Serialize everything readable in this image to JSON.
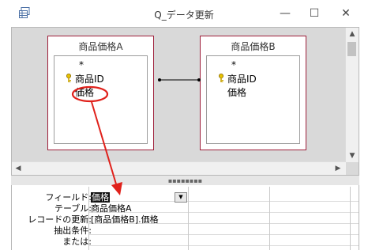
{
  "window": {
    "title": "Q_データ更新",
    "controls": {
      "minimize": "—",
      "maximize": "☐",
      "close": "✕"
    }
  },
  "design": {
    "tables": [
      {
        "name": "商品価格A",
        "star": "*",
        "fields": [
          "商品ID",
          "価格"
        ],
        "key_field": "商品ID"
      },
      {
        "name": "商品価格B",
        "star": "*",
        "fields": [
          "商品ID",
          "価格"
        ],
        "key_field": "商品ID"
      }
    ],
    "relationship": "商品ID",
    "highlighted_field": "価格"
  },
  "grid": {
    "row_labels": [
      "フィールド:",
      "テーブル:",
      "レコードの更新:",
      "抽出条件:",
      "または:"
    ],
    "column1": {
      "field": "価格",
      "table": "商品価格A",
      "update_to": "[商品価格B].価格",
      "criteria": "",
      "or": ""
    }
  },
  "colors": {
    "table_border": "#9e1f3a",
    "annotation": "#e0211b",
    "design_bg": "#d9d9d9"
  }
}
